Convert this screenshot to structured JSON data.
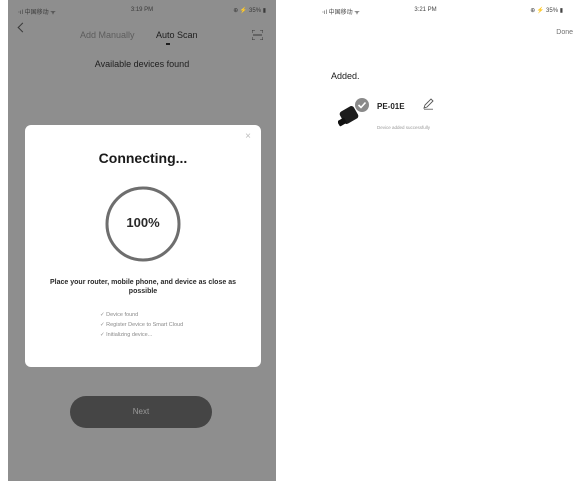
{
  "left": {
    "status_bar": {
      "carrier": "⋅ıl 中国移动 ᯤ",
      "time": "3:19 PM",
      "battery": "⊕ ⚡ 35% ▮"
    },
    "tabs": [
      {
        "label": "Add Manually"
      },
      {
        "label": "Auto Scan"
      }
    ],
    "heading": "Available devices found",
    "dialog": {
      "close": "×",
      "title": "Connecting...",
      "progress_label": "100%",
      "progress_fraction": 1.0,
      "hint": "Place your router, mobile phone, and device as close as possible",
      "steps": [
        "✓ Device found",
        "✓ Register Device to Smart Cloud",
        "✓ Initializing device..."
      ]
    },
    "next_label": "Next"
  },
  "right": {
    "status_bar": {
      "carrier": "⋅ıl 中国移动 ᯤ",
      "time": "3:21 PM",
      "battery": "⊕ ⚡ 35% ▮"
    },
    "done_label": "Done",
    "added_title": "Added.",
    "device": {
      "name": "PE-01E",
      "status": "Device added successfully"
    }
  },
  "colors": {
    "overlay": "#8e8e8e",
    "button": "#454545",
    "dialog": "#ffffff"
  }
}
